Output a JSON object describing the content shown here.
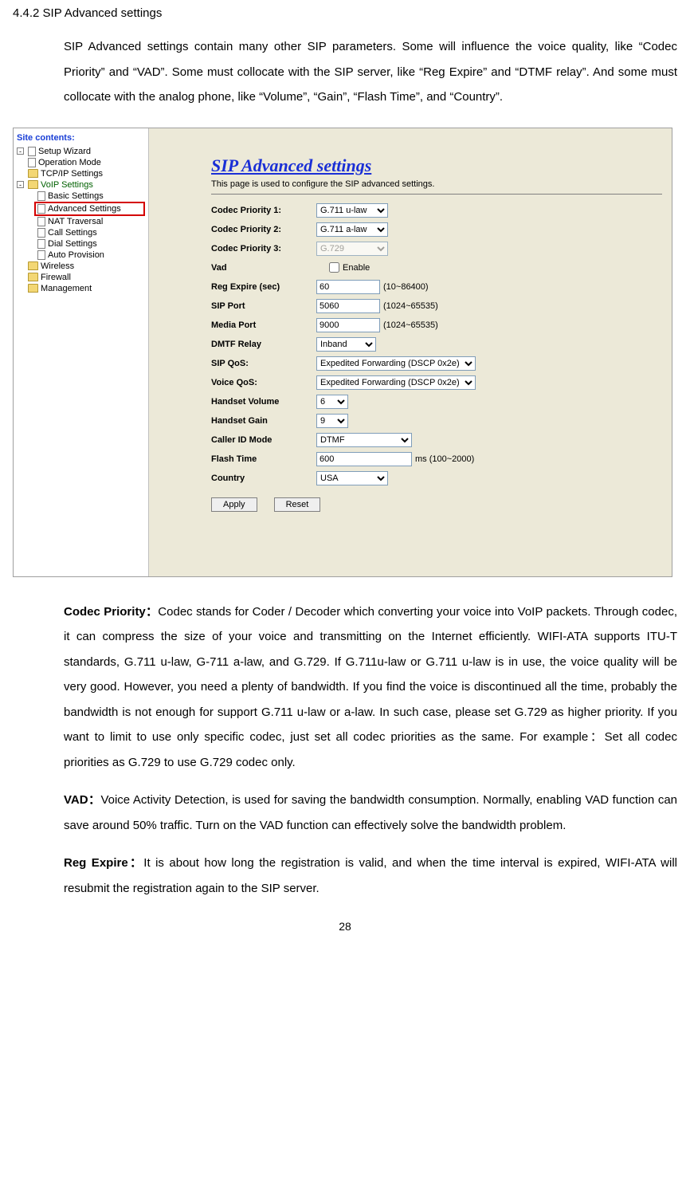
{
  "section_heading": "4.4.2 SIP Advanced settings",
  "intro_text": "SIP Advanced settings contain many other SIP parameters. Some will influence the voice quality, like “Codec Priority” and “VAD”. Some must collocate with the SIP server, like “Reg Expire” and “DTMF relay”. And some must collocate with the analog phone, like “Volume”, “Gain”, “Flash Time”, and “Country”.",
  "tree": {
    "title": "Site contents:",
    "items": [
      "Setup Wizard",
      "Operation Mode",
      "TCP/IP Settings",
      "VoIP Settings",
      "Wireless",
      "Firewall",
      "Management"
    ],
    "voip_children": [
      "Basic Settings",
      "Advanced Settings",
      "NAT Traversal",
      "Call Settings",
      "Dial Settings",
      "Auto Provision"
    ]
  },
  "panel": {
    "title": "SIP Advanced settings",
    "subtitle": "This page is used to configure the SIP advanced settings.",
    "labels": {
      "codec1": "Codec Priority 1:",
      "codec2": "Codec Priority 2:",
      "codec3": "Codec Priority 3:",
      "vad": "Vad",
      "reg": "Reg Expire (sec)",
      "sipport": "SIP Port",
      "mediaport": "Media Port",
      "dtmf": "DMTF Relay",
      "sipqos": "SIP QoS:",
      "voiceqos": "Voice QoS:",
      "handvol": "Handset Volume",
      "handgain": "Handset Gain",
      "callerid": "Caller ID Mode",
      "flash": "Flash Time",
      "country": "Country"
    },
    "values": {
      "codec1": "G.711 u-law",
      "codec2": "G.711 a-law",
      "codec3": "G.729",
      "vad_enable": "Enable",
      "reg": "60",
      "reg_hint": "(10~86400)",
      "sipport": "5060",
      "sipport_hint": "(1024~65535)",
      "mediaport": "9000",
      "mediaport_hint": "(1024~65535)",
      "dtmf": "Inband",
      "sipqos": "Expedited Forwarding (DSCP 0x2e)",
      "voiceqos": "Expedited Forwarding (DSCP 0x2e)",
      "handvol": "6",
      "handgain": "9",
      "callerid": "DTMF",
      "flash": "600",
      "flash_hint": "ms (100~2000)",
      "country": "USA"
    },
    "buttons": {
      "apply": "Apply",
      "reset": "Reset"
    }
  },
  "descriptions": {
    "codec_label": "Codec Priority：",
    "codec_text": "Codec stands for Coder / Decoder which converting your voice into VoIP packets. Through codec, it can compress the size of your voice and transmitting on the Internet efficiently. WIFI-ATA supports ITU-T standards, G.711 u-law, G-711 a-law, and G.729. If G.711u-law or G.711 u-law is in use, the voice quality will be very good. However, you need a plenty of bandwidth. If you find the voice is discontinued all the time, probably the bandwidth is not enough for support G.711 u-law or a-law. In such case, please set G.729 as higher priority. If you want to limit to use only specific codec, just set all codec priorities as the same. For example：Set all codec priorities as G.729 to use G.729 codec only.",
    "vad_label": "VAD：",
    "vad_text": "Voice Activity Detection, is used for saving the bandwidth consumption. Normally, enabling VAD function can save around 50% traffic. Turn on the VAD function can effectively solve the bandwidth problem.",
    "reg_label": "Reg Expire：",
    "reg_text": "It is about how long the registration is valid, and when the time interval is expired, WIFI-ATA will resubmit the registration again to the SIP server."
  },
  "page_number": "28"
}
